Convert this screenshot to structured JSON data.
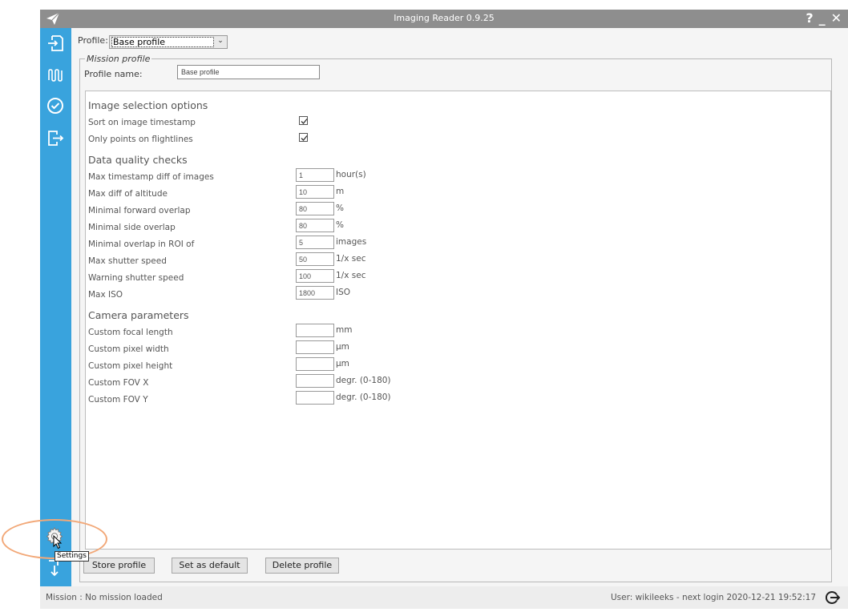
{
  "app": {
    "title": "Imaging Reader 0.9.25"
  },
  "window_controls": {
    "help": "?",
    "minimize": "_",
    "close": "✕"
  },
  "sidebar": {
    "items": [
      {
        "name": "import-icon"
      },
      {
        "name": "flightlines-icon"
      },
      {
        "name": "check-icon"
      },
      {
        "name": "export-icon"
      }
    ],
    "settings_tooltip": "Settings"
  },
  "profile": {
    "label": "Profile:",
    "selected": "Base profile"
  },
  "mission": {
    "legend": "Mission profile",
    "name_label": "Profile name:",
    "name_value": "Base profile"
  },
  "image_selection": {
    "title": "Image selection options",
    "rows": [
      {
        "label": "Sort on image timestamp",
        "checked": true
      },
      {
        "label": "Only points on flightlines",
        "checked": true
      }
    ]
  },
  "quality": {
    "title": "Data quality checks",
    "rows": [
      {
        "label": "Max timestamp diff of images",
        "value": "1",
        "unit": "hour(s)"
      },
      {
        "label": "Max diff of altitude",
        "value": "10",
        "unit": "m"
      },
      {
        "label": "Minimal forward overlap",
        "value": "80",
        "unit": "%"
      },
      {
        "label": "Minimal side overlap",
        "value": "80",
        "unit": "%"
      },
      {
        "label": "Minimal overlap in ROI of",
        "value": "5",
        "unit": "images"
      },
      {
        "label": "Max shutter speed",
        "value": "50",
        "unit": "1/x sec"
      },
      {
        "label": "Warning shutter speed",
        "value": "100",
        "unit": "1/x sec"
      },
      {
        "label": "Max ISO",
        "value": "1800",
        "unit": "ISO"
      }
    ]
  },
  "camera": {
    "title": "Camera parameters",
    "rows": [
      {
        "label": "Custom focal length",
        "value": "",
        "unit": "mm"
      },
      {
        "label": "Custom pixel width",
        "value": "",
        "unit": "μm"
      },
      {
        "label": "Custom pixel height",
        "value": "",
        "unit": "μm"
      },
      {
        "label": "Custom FOV X",
        "value": "",
        "unit": "degr. (0-180)"
      },
      {
        "label": "Custom FOV Y",
        "value": "",
        "unit": "degr. (0-180)"
      }
    ]
  },
  "buttons": {
    "store": "Store profile",
    "set_default": "Set as default",
    "delete": "Delete profile"
  },
  "status": {
    "mission": "Mission : No mission loaded",
    "user": "User: wikileeks - next login 2020-12-21 19:52:17"
  },
  "colors": {
    "sidebar": "#39a3dd",
    "titlebar": "#8e8e8e",
    "highlight": "#f2a878"
  }
}
